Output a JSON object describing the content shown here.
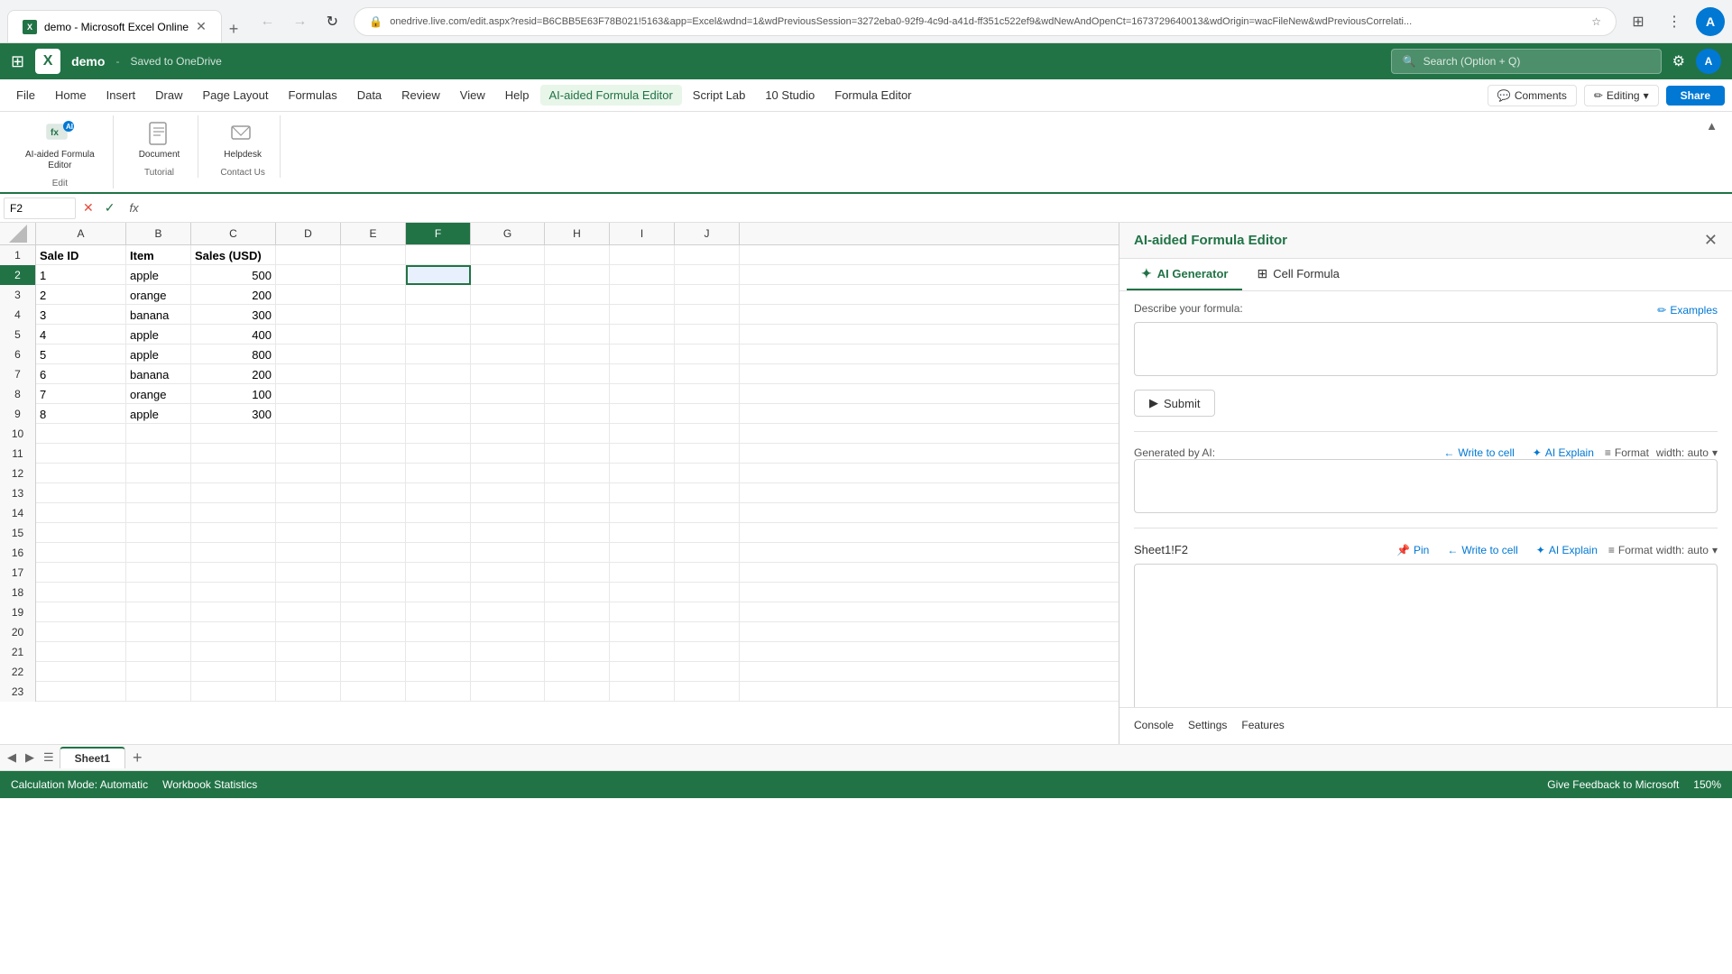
{
  "browser": {
    "tab_label": "demo - Microsoft Excel Online",
    "new_tab_icon": "+",
    "back_icon": "←",
    "forward_icon": "→",
    "refresh_icon": "↻",
    "address": "onedrive.live.com/edit.aspx?resid=B6CBB5E63F78B021!5163&app=Excel&wdnd=1&wdPreviousSession=3272eba0-92f9-4c9d-a41d-ff351c522ef9&wdNewAndOpenCt=1673729640013&wdOrigin=wacFileNew&wdPreviousCorrelati...",
    "profile_initial": "A",
    "extensions_icon": "⋮"
  },
  "appbar": {
    "grid_icon": "⊞",
    "logo_text": "X",
    "title": "demo",
    "separator": "-",
    "save_status": "Saved to OneDrive",
    "search_placeholder": "Search (Option + Q)",
    "search_icon": "🔍",
    "settings_icon": "⚙",
    "profile_initial": "A"
  },
  "menu": {
    "items": [
      {
        "label": "File",
        "active": false
      },
      {
        "label": "Home",
        "active": false
      },
      {
        "label": "Insert",
        "active": false
      },
      {
        "label": "Draw",
        "active": false
      },
      {
        "label": "Page Layout",
        "active": false
      },
      {
        "label": "Formulas",
        "active": false
      },
      {
        "label": "Data",
        "active": false
      },
      {
        "label": "Review",
        "active": false
      },
      {
        "label": "View",
        "active": false
      },
      {
        "label": "Help",
        "active": false
      },
      {
        "label": "AI-aided Formula Editor",
        "active": true
      },
      {
        "label": "Script Lab",
        "active": false
      },
      {
        "label": "10 Studio",
        "active": false
      },
      {
        "label": "Formula Editor",
        "active": false
      }
    ],
    "comments_label": "Comments",
    "editing_label": "Editing",
    "editing_dropdown": "▾",
    "share_label": "Share"
  },
  "ribbon": {
    "ai_formula_btn_label": "AI-aided Formula Editor",
    "document_btn_label": "Document",
    "helpdesk_btn_label": "Helpdesk",
    "group_edit_label": "Edit",
    "group_tutorial_label": "Tutorial",
    "group_contact_label": "Contact Us",
    "collapse_icon": "▲"
  },
  "formula_bar": {
    "cell_ref": "F2",
    "cancel_icon": "✕",
    "confirm_icon": "✓",
    "fx_label": "fx",
    "formula_value": ""
  },
  "spreadsheet": {
    "columns": [
      "A",
      "B",
      "C",
      "D",
      "E",
      "F",
      "G",
      "H",
      "I",
      "J"
    ],
    "selected_col": "F",
    "selected_row": 2,
    "selected_cell": "F2",
    "headers": {
      "a1": "Sale ID",
      "b1": "Item",
      "c1": "Sales (USD)"
    },
    "rows": [
      {
        "num": 1,
        "a": "Sale ID",
        "b": "Item",
        "c": "Sales (USD)",
        "d": "",
        "e": "",
        "f": "",
        "g": "",
        "h": "",
        "i": "",
        "j": ""
      },
      {
        "num": 2,
        "a": "1",
        "b": "apple",
        "c": "500",
        "d": "",
        "e": "",
        "f": "",
        "g": "",
        "h": "",
        "i": "",
        "j": ""
      },
      {
        "num": 3,
        "a": "2",
        "b": "orange",
        "c": "200",
        "d": "",
        "e": "",
        "f": "",
        "g": "",
        "h": "",
        "i": "",
        "j": ""
      },
      {
        "num": 4,
        "a": "3",
        "b": "banana",
        "c": "300",
        "d": "",
        "e": "",
        "f": "",
        "g": "",
        "h": "",
        "i": "",
        "j": ""
      },
      {
        "num": 5,
        "a": "4",
        "b": "apple",
        "c": "400",
        "d": "",
        "e": "",
        "f": "",
        "g": "",
        "h": "",
        "i": "",
        "j": ""
      },
      {
        "num": 6,
        "a": "5",
        "b": "apple",
        "c": "800",
        "d": "",
        "e": "",
        "f": "",
        "g": "",
        "h": "",
        "i": "",
        "j": ""
      },
      {
        "num": 7,
        "a": "6",
        "b": "banana",
        "c": "200",
        "d": "",
        "e": "",
        "f": "",
        "g": "",
        "h": "",
        "i": "",
        "j": ""
      },
      {
        "num": 8,
        "a": "7",
        "b": "orange",
        "c": "100",
        "d": "",
        "e": "",
        "f": "",
        "g": "",
        "h": "",
        "i": "",
        "j": ""
      },
      {
        "num": 9,
        "a": "8",
        "b": "apple",
        "c": "300",
        "d": "",
        "e": "",
        "f": "",
        "g": "",
        "h": "",
        "i": "",
        "j": ""
      },
      {
        "num": 10,
        "a": "",
        "b": "",
        "c": "",
        "d": "",
        "e": "",
        "f": "",
        "g": "",
        "h": "",
        "i": "",
        "j": ""
      },
      {
        "num": 11,
        "a": "",
        "b": "",
        "c": "",
        "d": "",
        "e": "",
        "f": "",
        "g": "",
        "h": "",
        "i": "",
        "j": ""
      },
      {
        "num": 12,
        "a": "",
        "b": "",
        "c": "",
        "d": "",
        "e": "",
        "f": "",
        "g": "",
        "h": "",
        "i": "",
        "j": ""
      },
      {
        "num": 13,
        "a": "",
        "b": "",
        "c": "",
        "d": "",
        "e": "",
        "f": "",
        "g": "",
        "h": "",
        "i": "",
        "j": ""
      },
      {
        "num": 14,
        "a": "",
        "b": "",
        "c": "",
        "d": "",
        "e": "",
        "f": "",
        "g": "",
        "h": "",
        "i": "",
        "j": ""
      },
      {
        "num": 15,
        "a": "",
        "b": "",
        "c": "",
        "d": "",
        "e": "",
        "f": "",
        "g": "",
        "h": "",
        "i": "",
        "j": ""
      },
      {
        "num": 16,
        "a": "",
        "b": "",
        "c": "",
        "d": "",
        "e": "",
        "f": "",
        "g": "",
        "h": "",
        "i": "",
        "j": ""
      },
      {
        "num": 17,
        "a": "",
        "b": "",
        "c": "",
        "d": "",
        "e": "",
        "f": "",
        "g": "",
        "h": "",
        "i": "",
        "j": ""
      },
      {
        "num": 18,
        "a": "",
        "b": "",
        "c": "",
        "d": "",
        "e": "",
        "f": "",
        "g": "",
        "h": "",
        "i": "",
        "j": ""
      },
      {
        "num": 19,
        "a": "",
        "b": "",
        "c": "",
        "d": "",
        "e": "",
        "f": "",
        "g": "",
        "h": "",
        "i": "",
        "j": ""
      },
      {
        "num": 20,
        "a": "",
        "b": "",
        "c": "",
        "d": "",
        "e": "",
        "f": "",
        "g": "",
        "h": "",
        "i": "",
        "j": ""
      },
      {
        "num": 21,
        "a": "",
        "b": "",
        "c": "",
        "d": "",
        "e": "",
        "f": "",
        "g": "",
        "h": "",
        "i": "",
        "j": ""
      },
      {
        "num": 22,
        "a": "",
        "b": "",
        "c": "",
        "d": "",
        "e": "",
        "f": "",
        "g": "",
        "h": "",
        "i": "",
        "j": ""
      },
      {
        "num": 23,
        "a": "",
        "b": "",
        "c": "",
        "d": "",
        "e": "",
        "f": "",
        "g": "",
        "h": "",
        "i": "",
        "j": ""
      }
    ]
  },
  "right_panel": {
    "title": "AI-aided Formula Editor",
    "close_icon": "✕",
    "tabs": [
      {
        "label": "AI Generator",
        "icon": "✦",
        "active": true
      },
      {
        "label": "Cell Formula",
        "icon": "⊞",
        "active": false
      }
    ],
    "describe_label": "Describe your formula:",
    "describe_placeholder": "",
    "examples_label": "Examples",
    "pencil_icon": "✏",
    "submit_label": "Submit",
    "submit_icon": "▶",
    "generated_label": "Generated by AI:",
    "write_to_cell_label": "Write to cell",
    "ai_explain_label": "AI Explain",
    "format_label": "Format",
    "width_label": "width: auto",
    "dropdown_icon": "▾",
    "arrow_icon": "←",
    "sheet_ref": "Sheet1!F2",
    "pin_label": "Pin",
    "pin_icon": "📌",
    "write_to_cell_label2": "Write to cell",
    "ai_explain_label2": "AI Explain",
    "format_label2": "Format",
    "width_label2": "width: auto",
    "footer_tabs": [
      "Console",
      "Settings",
      "Features"
    ]
  },
  "sheet_tabs": {
    "tabs": [
      {
        "label": "Sheet1",
        "active": true
      }
    ],
    "add_icon": "+"
  },
  "status_bar": {
    "calc_mode": "Calculation Mode: Automatic",
    "workbook_stats": "Workbook Statistics",
    "feedback_label": "Give Feedback to Microsoft",
    "zoom_level": "150%"
  }
}
